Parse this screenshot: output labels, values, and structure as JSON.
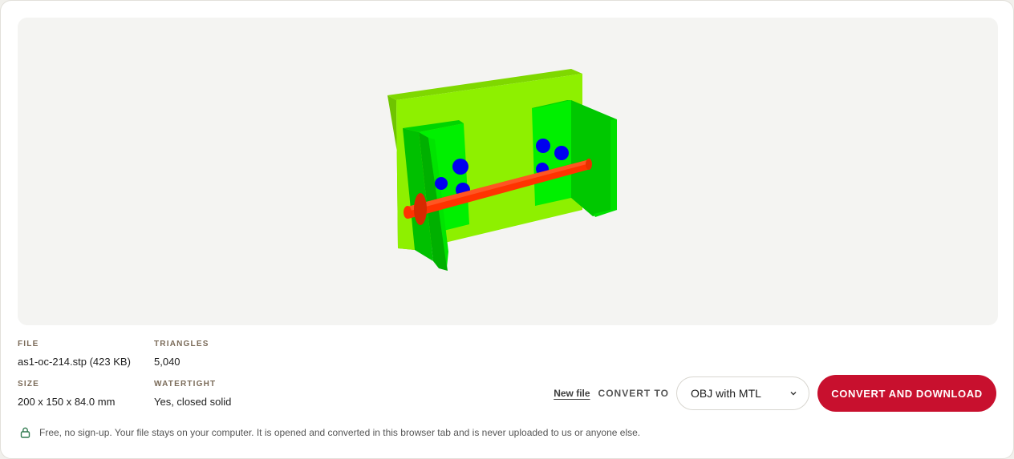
{
  "viewer": {
    "model_colors": {
      "plate": "#8ef000",
      "plate_shade": "#6fc400",
      "bracket": "#00f000",
      "bracket_shade": "#00b800",
      "holes": "#0000f0",
      "rod": "#ff3300",
      "rod_shade": "#cc2200"
    }
  },
  "meta": {
    "file_label": "FILE",
    "file_value": "as1-oc-214.stp (423 KB)",
    "triangles_label": "TRIANGLES",
    "triangles_value": "5,040",
    "size_label": "SIZE",
    "size_value": "200 x 150 x 84.0 mm",
    "watertight_label": "WATERTIGHT",
    "watertight_value": "Yes, closed solid"
  },
  "actions": {
    "new_file_label": "New file",
    "convert_to_label": "CONVERT TO",
    "format_selected": "OBJ with MTL",
    "convert_button_label": "CONVERT AND DOWNLOAD"
  },
  "footer": {
    "privacy_icon": "lock-icon",
    "privacy_note": "Free, no sign-up. Your file stays on your computer. It is opened and converted in this browser tab and is never uploaded to us or anyone else."
  },
  "colors": {
    "accent": "#c8102e",
    "viewer_bg": "#f4f4f2"
  }
}
